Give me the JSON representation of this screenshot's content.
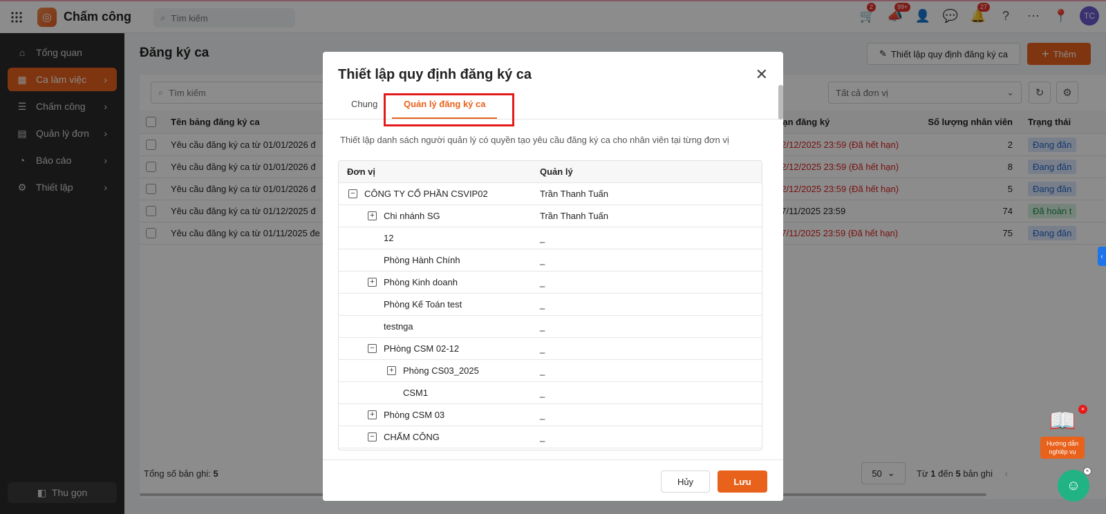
{
  "app": {
    "title": "Chấm công",
    "search_placeholder": "Tìm kiếm"
  },
  "top_icons": [
    {
      "name": "cart-icon",
      "badge": "2"
    },
    {
      "name": "megaphone-icon",
      "badge": "99+"
    },
    {
      "name": "add-user-icon",
      "badge": ""
    },
    {
      "name": "chat-icon",
      "badge": ""
    },
    {
      "name": "bell-icon",
      "badge": "27"
    },
    {
      "name": "help-icon",
      "badge": ""
    },
    {
      "name": "more-icon",
      "badge": ""
    },
    {
      "name": "location-icon",
      "badge": ""
    }
  ],
  "avatar": "TC",
  "sidebar": {
    "items": [
      {
        "label": "Tổng quan",
        "icon": "home-icon",
        "active": false,
        "has_chevron": false
      },
      {
        "label": "Ca làm việc",
        "icon": "calendar-icon",
        "active": true,
        "has_chevron": true
      },
      {
        "label": "Chấm công",
        "icon": "list-check-icon",
        "active": false,
        "has_chevron": true
      },
      {
        "label": "Quản lý đơn",
        "icon": "document-icon",
        "active": false,
        "has_chevron": true
      },
      {
        "label": "Báo cáo",
        "icon": "pie-chart-icon",
        "active": false,
        "has_chevron": true
      },
      {
        "label": "Thiết lập",
        "icon": "gear-icon",
        "active": false,
        "has_chevron": true
      }
    ],
    "collapse_label": "Thu gọn"
  },
  "page": {
    "title": "Đăng ký ca",
    "setting_button": "Thiết lập quy định đăng ký ca",
    "add_button": "Thêm",
    "search_placeholder": "Tìm kiếm",
    "unit_filter": "Tất cả đơn vị"
  },
  "table": {
    "headers": {
      "name": "Tên bảng đăng ký ca",
      "deadline": "Hạn đăng ký",
      "count": "Số lượng nhân viên",
      "status": "Trạng thái"
    },
    "rows": [
      {
        "name": "Yêu cầu đăng ký ca từ 01/01/2026 đ",
        "deadline": "02/12/2025 23:59 (Đã hết hạn)",
        "expired": true,
        "count": "2",
        "status": "Đang đăn",
        "done": false
      },
      {
        "name": "Yêu cầu đăng ký ca từ 01/01/2026 đ",
        "deadline": "02/12/2025 23:59 (Đã hết hạn)",
        "expired": true,
        "count": "8",
        "status": "Đang đăn",
        "done": false
      },
      {
        "name": "Yêu cầu đăng ký ca từ 01/01/2026 đ",
        "deadline": "02/12/2025 23:59 (Đã hết hạn)",
        "expired": true,
        "count": "5",
        "status": "Đang đăn",
        "done": false
      },
      {
        "name": "Yêu cầu đăng ký ca từ 01/12/2025 đ",
        "deadline": "17/11/2025 23:59",
        "expired": false,
        "count": "74",
        "status": "Đã hoàn t",
        "done": true
      },
      {
        "name": "Yêu cầu đăng ký ca từ 01/11/2025 đe",
        "deadline": "17/11/2025 23:59 (Đã hết hạn)",
        "expired": true,
        "count": "75",
        "status": "Đang đăn",
        "done": false
      }
    ]
  },
  "footer": {
    "total_label": "Tổng số bản ghi:",
    "total_value": "5",
    "page_size": "50",
    "range_prefix": "Từ",
    "range_from": "1",
    "range_mid": "đến",
    "range_to": "5",
    "range_suffix": "bản ghi"
  },
  "modal": {
    "title": "Thiết lập quy định đăng ký ca",
    "tabs": [
      "Chung",
      "Quản lý đăng ký ca"
    ],
    "active_tab": 1,
    "description": "Thiết lập danh sách người quản lý có quyền tạo yêu cầu đăng ký ca cho nhân viên tại từng đơn vị",
    "tree_headers": {
      "unit": "Đơn vị",
      "manager": "Quản lý"
    },
    "tree_rows": [
      {
        "unit": "CÔNG TY CỔ PHẦN CSVIP02",
        "manager": "Trần Thanh Tuấn",
        "level": 0,
        "toggle": "−"
      },
      {
        "unit": "Chi nhánh SG",
        "manager": "Trần Thanh Tuấn",
        "level": 1,
        "toggle": "+"
      },
      {
        "unit": "12",
        "manager": "_",
        "level": 1,
        "toggle": ""
      },
      {
        "unit": "Phòng Hành Chính",
        "manager": "_",
        "level": 1,
        "toggle": ""
      },
      {
        "unit": "Phòng Kinh doanh",
        "manager": "_",
        "level": 1,
        "toggle": "+"
      },
      {
        "unit": "Phòng Kế Toán test",
        "manager": "_",
        "level": 1,
        "toggle": ""
      },
      {
        "unit": "testnga",
        "manager": "_",
        "level": 1,
        "toggle": ""
      },
      {
        "unit": "PHòng CSM 02-12",
        "manager": "_",
        "level": 1,
        "toggle": "−"
      },
      {
        "unit": "Phòng CS03_2025",
        "manager": "_",
        "level": 2,
        "toggle": "+"
      },
      {
        "unit": "CSM1",
        "manager": "_",
        "level": 2,
        "toggle": ""
      },
      {
        "unit": "Phòng CSM 03",
        "manager": "_",
        "level": 1,
        "toggle": "+"
      },
      {
        "unit": "CHẤM CÔNG",
        "manager": "_",
        "level": 1,
        "toggle": "−"
      }
    ],
    "cancel": "Hủy",
    "save": "Lưu"
  },
  "guide_widget": {
    "line1": "Hướng dẫn",
    "line2": "nghiệp vụ"
  }
}
